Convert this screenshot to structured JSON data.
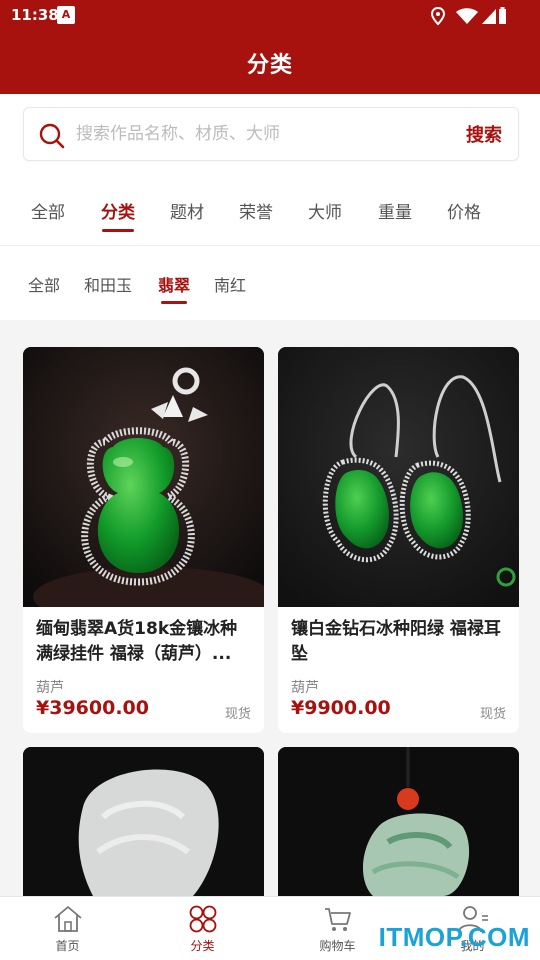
{
  "status_bar": {
    "time": "11:38",
    "app_icon": "A"
  },
  "header": {
    "title": "分类"
  },
  "search": {
    "placeholder": "搜索作品名称、材质、大师",
    "button_label": "搜索"
  },
  "tabs": [
    {
      "label": "全部"
    },
    {
      "label": "分类"
    },
    {
      "label": "题材"
    },
    {
      "label": "荣誉"
    },
    {
      "label": "大师"
    },
    {
      "label": "重量"
    },
    {
      "label": "价格"
    }
  ],
  "active_tab": "分类",
  "subtabs": [
    {
      "label": "全部"
    },
    {
      "label": "和田玉"
    },
    {
      "label": "翡翠"
    },
    {
      "label": "南红"
    }
  ],
  "active_subtab": "翡翠",
  "products": [
    {
      "name": "缅甸翡翠A货18k金镶冰种满绿挂件 福禄（葫芦）...",
      "category": "葫芦",
      "price": "¥39600.00",
      "stock": "现货"
    },
    {
      "name": "镶白金钻石冰种阳绿 福禄耳坠",
      "category": "葫芦",
      "price": "¥9900.00",
      "stock": "现货"
    }
  ],
  "bottom_nav": [
    {
      "label": "首页",
      "icon": "home-icon"
    },
    {
      "label": "分类",
      "icon": "category-grid-icon"
    },
    {
      "label": "购物车",
      "icon": "cart-icon"
    },
    {
      "label": "我的",
      "icon": "user-icon"
    }
  ],
  "watermark": "ITMOP.COM",
  "colors": {
    "brand": "#a8120e",
    "background": "#f4f4f4",
    "watermark": "#1aa3d9"
  }
}
